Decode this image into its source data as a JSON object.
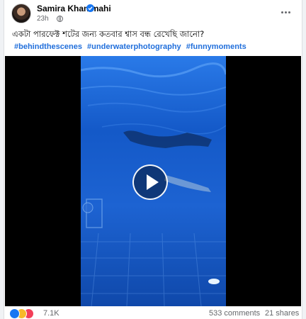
{
  "post": {
    "author": "Samira Khan mahi",
    "time": "23h",
    "caption": "একটা পারফেক্ট শটের জন্য কতবার শ্বাস বন্ধ রেখেছি জানো?",
    "hashtags": [
      "#behindthescenes",
      "#underwaterphotography",
      "#funnymoments"
    ]
  },
  "stats": {
    "reactions": "7.1K",
    "comments": "533 comments",
    "shares": "21 shares"
  },
  "icons": {
    "verified": "verified-badge-icon",
    "privacy": "globe-icon",
    "menu": "more-options-icon",
    "play": "play-icon",
    "reactions": [
      "like-icon",
      "haha-icon",
      "love-icon"
    ]
  },
  "colors": {
    "link": "#216fdb",
    "like": "#1877f2",
    "love": "#f33e58",
    "haha": "#f7b928",
    "water": "#1a5fd0"
  }
}
